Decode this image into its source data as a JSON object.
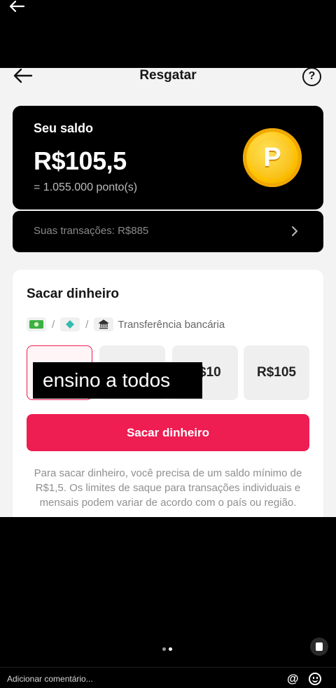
{
  "navbar": {
    "title": "Resgatar",
    "help_glyph": "?"
  },
  "balance": {
    "label": "Seu saldo",
    "amount": "R$105,5",
    "points": "= 1.055.000 ponto(s)",
    "coin_letter": "P"
  },
  "transactions": {
    "text": "Suas transações: R$885"
  },
  "withdraw": {
    "title": "Sacar dinheiro",
    "method": "Transferência bancária",
    "method_sep": "/",
    "amounts": [
      "",
      "",
      "R$10",
      "R$105"
    ],
    "button_label": "Sacar dinheiro",
    "note": "Para sacar dinheiro, você precisa de um saldo mínimo de R$1,5. Os limites de saque para transações individuais e mensais podem variar de acordo com o país ou região."
  },
  "overlay_caption": "ensino a todos",
  "comment": {
    "placeholder": "Adicionar comentário...",
    "at_glyph": "@"
  },
  "colors": {
    "accent": "#EE1D52",
    "card": "#000000",
    "coin": "#FFC400"
  }
}
